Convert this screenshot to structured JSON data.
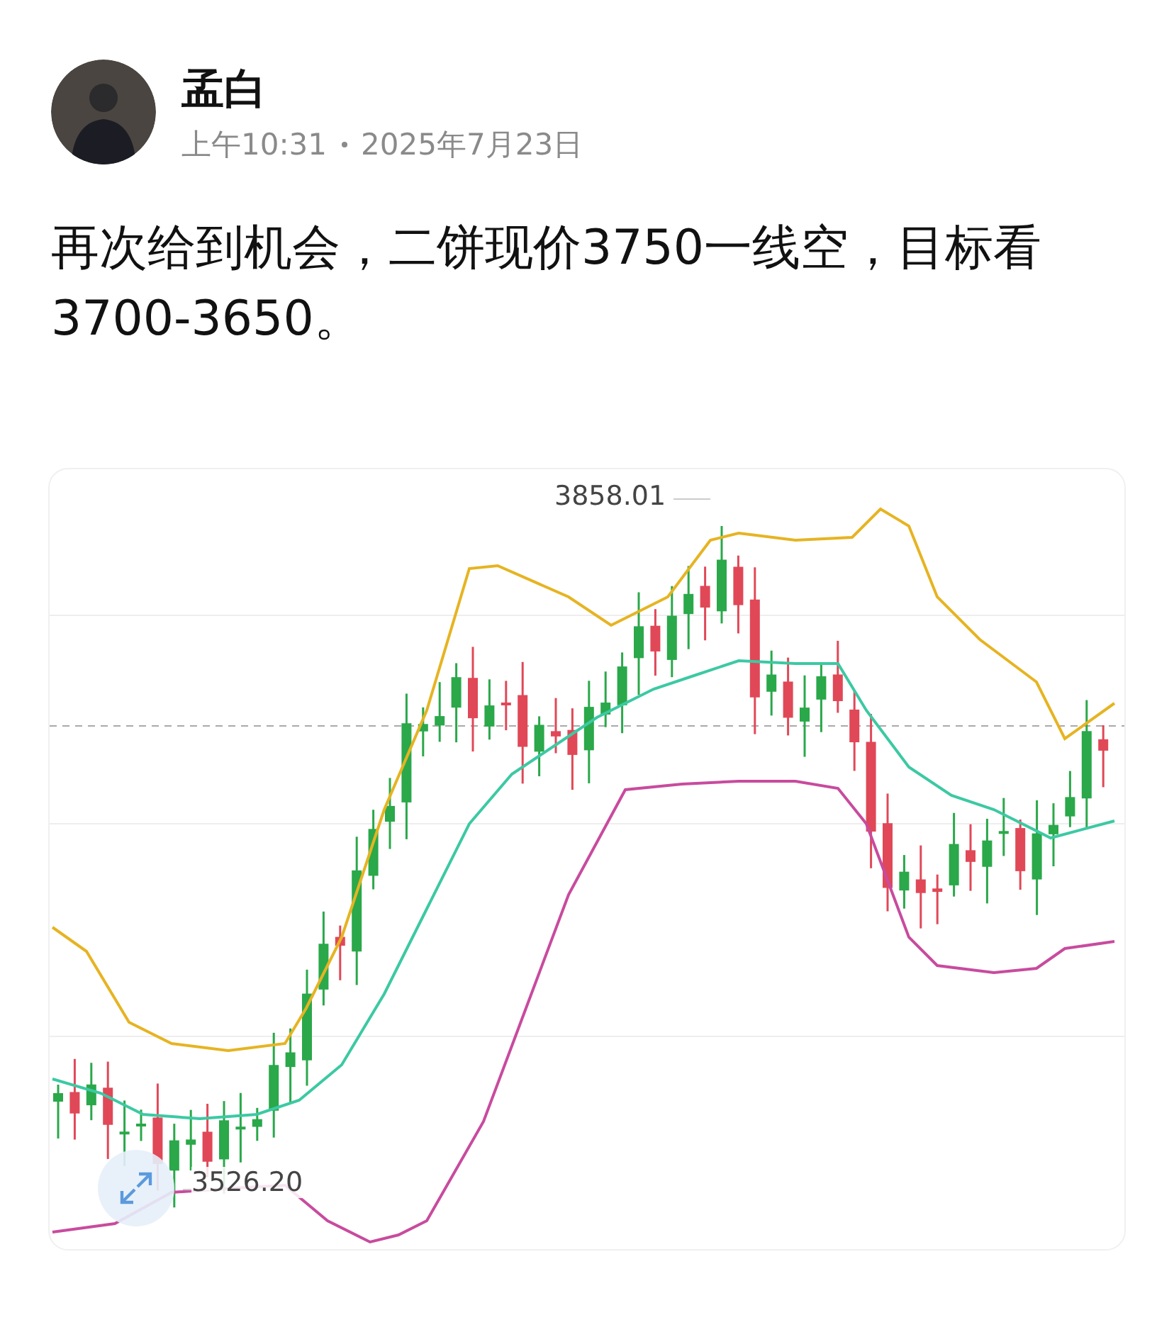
{
  "author": {
    "name": "孟白",
    "time": "上午10:31",
    "date": "2025年7月23日"
  },
  "post": {
    "text": "再次给到机会，二饼现价3750一线空，目标看3700-3650。"
  },
  "chart": {
    "high_label": "3858.01",
    "low_label": "3526.20"
  }
}
